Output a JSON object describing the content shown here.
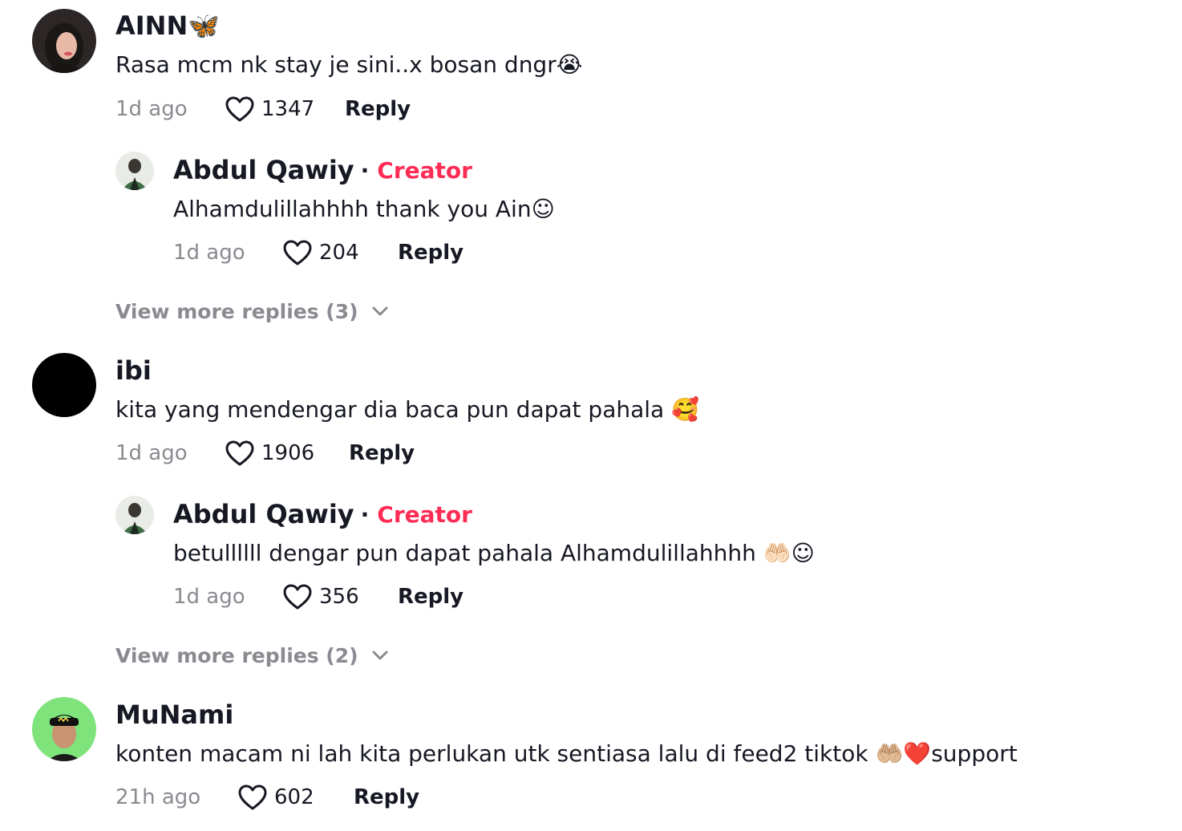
{
  "comments": [
    {
      "username": "AINN🦋",
      "text": "Rasa mcm nk stay je sini..x bosan dngr😭",
      "time": "1d ago",
      "likes": "1347",
      "reply_label": "Reply",
      "creator_reply": {
        "username": "Abdul Qawiy",
        "separator": "·",
        "badge": "Creator",
        "text": "Alhamdulillahhhh thank you Ain☺",
        "time": "1d ago",
        "likes": "204",
        "reply_label": "Reply"
      },
      "view_more": "View more replies (3)"
    },
    {
      "username": "ibi",
      "text": "kita yang mendengar dia baca pun dapat pahala 🥰",
      "time": "1d ago",
      "likes": "1906",
      "reply_label": "Reply",
      "creator_reply": {
        "username": "Abdul Qawiy",
        "separator": "·",
        "badge": "Creator",
        "text": "betullllll dengar pun dapat pahala Alhamdulillahhhh 🤲🏻☺",
        "time": "1d ago",
        "likes": "356",
        "reply_label": "Reply"
      },
      "view_more": "View more replies (2)"
    },
    {
      "username": "MuNami",
      "text": "konten macam ni lah kita perlukan utk sentiasa lalu di feed2 tiktok 🤲🏼❤️support",
      "time": "21h ago",
      "likes": "602",
      "reply_label": "Reply"
    }
  ],
  "colors": {
    "creator_badge": "#fe2c55",
    "muted_text": "#8a8b91",
    "primary_text": "#161823",
    "avatar_munami_bg": "#7ee37a"
  },
  "icons": {
    "like": "heart-outline-icon",
    "expand": "chevron-down-icon"
  }
}
